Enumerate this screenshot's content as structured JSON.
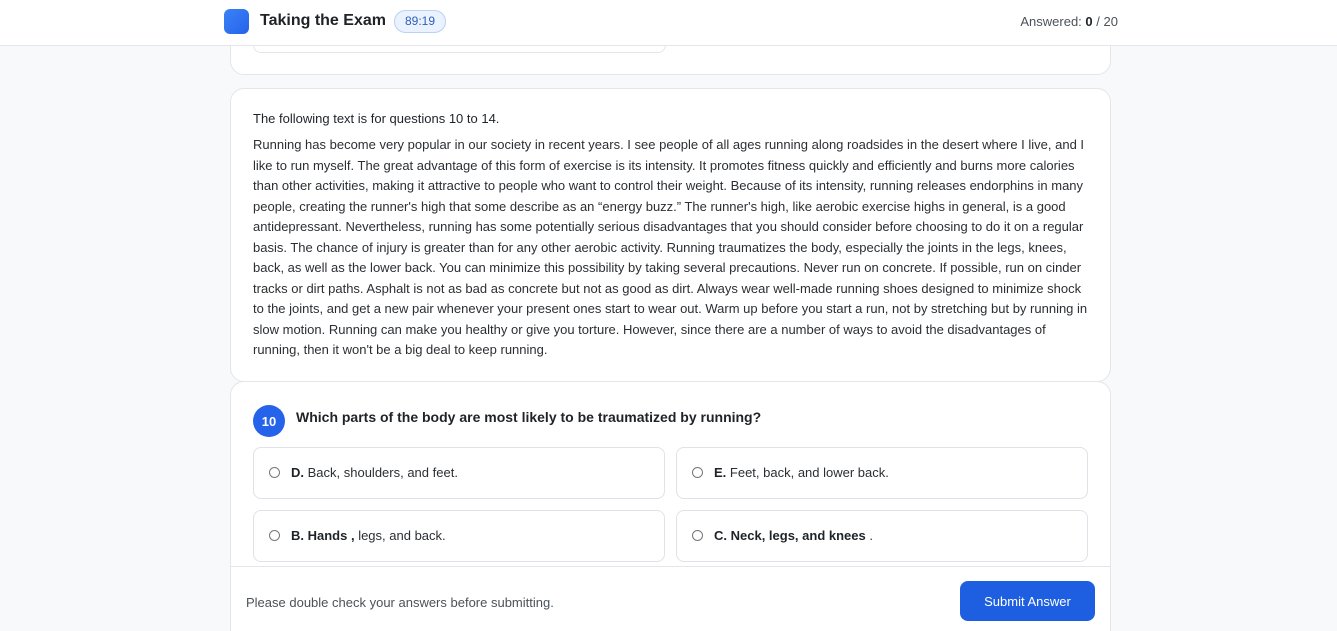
{
  "header": {
    "title": "Taking the Exam",
    "timer": "89:19",
    "answered_label": "Answered:",
    "answered_count": "0",
    "answered_sep": "/",
    "answered_total": "20"
  },
  "passage": {
    "intro": "The following text is for questions 10 to 14.",
    "text": "Running has become very popular in our society in recent years. I see people of all ages running along roadsides in the desert where I live, and I like to run myself. The great advantage of this form of exercise is its intensity. It promotes fitness quickly and efficiently and burns more calories than other activities, making it attractive to people who want to control their weight. Because of its intensity, running releases endorphins in many people, creating the runner's high that some describe as an “energy buzz.” The runner's high, like aerobic exercise highs in general, is a good antidepressant. Nevertheless, running has some potentially serious disadvantages that you should consider before choosing to do it on a regular basis. The chance of injury is greater than for any other aerobic activity. Running traumatizes the body, especially the joints in the legs, knees, back, as well as the lower back. You can minimize this possibility by taking several precautions. Never run on concrete. If possible, run on cinder tracks or dirt paths. Asphalt is not as bad as concrete but not as good as dirt. Always wear well-made running shoes designed to minimize shock to the joints, and get a new pair whenever your present ones start to wear out. Warm up before you start a run, not by stretching but by running in slow motion. Running can make you healthy or give you torture. However, since there are a number of ways to avoid the disadvantages of running, then it won't be a big deal to keep running."
  },
  "question": {
    "number": "10",
    "text": "Which parts of the body are most likely to be traumatized by running?",
    "options": [
      {
        "key": "D.",
        "text": " Back, shoulders, and feet."
      },
      {
        "key": "E.",
        "text": " Feet, back, and lower back."
      },
      {
        "key": "B. Hands ,",
        "text": " legs, and back."
      },
      {
        "key": "C. Neck, legs, and knees",
        "text": " ."
      }
    ]
  },
  "footer": {
    "message": "Please double check your answers before submitting.",
    "submit_label": "Submit Answer"
  }
}
